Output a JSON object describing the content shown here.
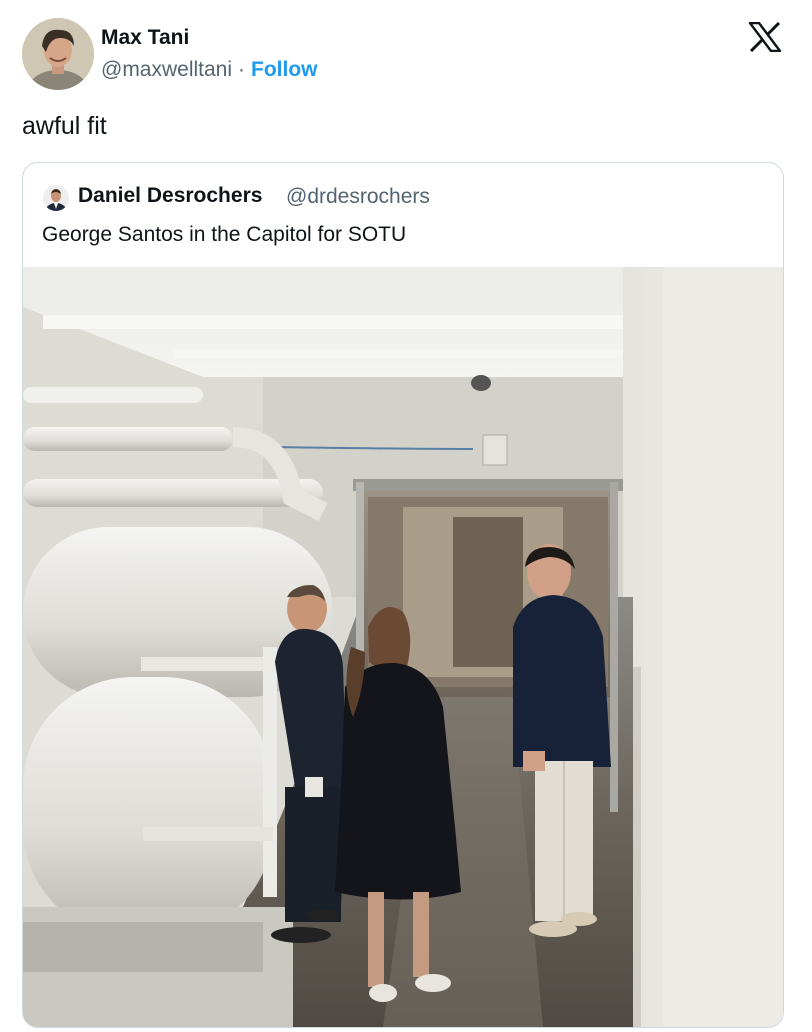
{
  "tweet": {
    "author_name": "Max Tani",
    "author_handle": "@maxwelltani",
    "separator": "·",
    "follow_label": "Follow",
    "text": "awful fit",
    "platform_icon": "x-logo-icon"
  },
  "quoted_tweet": {
    "author_name": "Daniel Desrochers",
    "author_handle": "@drdesrochers",
    "text": "George Santos in the Capitol for SOTU",
    "photo_icon": "photo-capitol-tunnel"
  },
  "colors": {
    "text_primary": "#0f1419",
    "text_secondary": "#536471",
    "accent": "#1d9bf0",
    "border": "#cfd9de"
  }
}
